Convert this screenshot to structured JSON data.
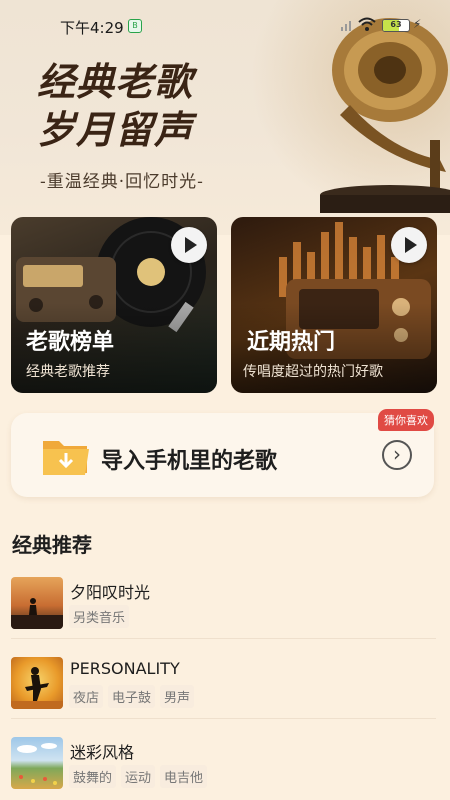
{
  "status_bar": {
    "time": "下午4:29",
    "notification_icon": "app-notification-icon",
    "battery_level": "63",
    "battery_fraction": 0.63
  },
  "hero": {
    "title_line1": "经典老歌",
    "title_line2": "岁月留声",
    "subtitle": "-重温经典·回忆时光-"
  },
  "cards": [
    {
      "title": "老歌榜单",
      "desc": "经典老歌推荐"
    },
    {
      "title": "近期热门",
      "desc": "传唱度超过的热门好歌"
    }
  ],
  "import_banner": {
    "label": "导入手机里的老歌",
    "tag": "猜你喜欢"
  },
  "section": {
    "title": "经典推荐"
  },
  "songs": [
    {
      "name": "夕阳叹时光",
      "tags": [
        "另类音乐"
      ]
    },
    {
      "name": "PERSONALITY",
      "tags": [
        "夜店",
        "电子鼓",
        "男声"
      ]
    },
    {
      "name": "迷彩风格",
      "tags": [
        "鼓舞的",
        "运动",
        "电吉他"
      ]
    }
  ],
  "colors": {
    "page_bg": "#fcf0df",
    "accent_tag": "#e04a44",
    "title_brown": "#3a2415"
  }
}
